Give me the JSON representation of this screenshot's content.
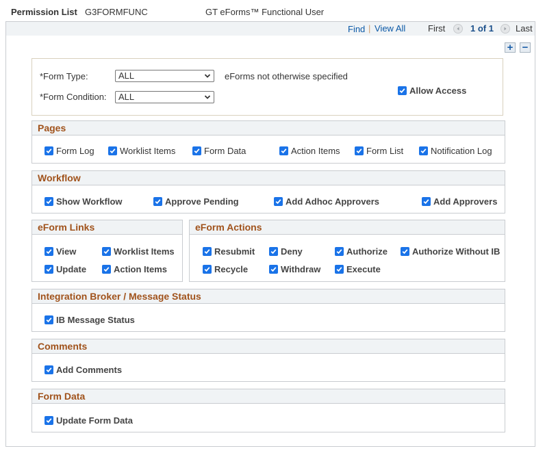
{
  "header": {
    "permission_list_label": "Permission List",
    "permission_list_value": "G3FORMFUNC",
    "description": "GT eForms™ Functional User"
  },
  "nav": {
    "find": "Find",
    "separator": "|",
    "view_all": "View All",
    "first": "First",
    "page_info": "1 of 1",
    "last": "Last"
  },
  "row_buttons": {
    "add": "+",
    "delete": "−"
  },
  "keys": {
    "form_type_label": "*Form Type:",
    "form_type_value": "ALL",
    "form_type_desc": "eForms not otherwise specified",
    "form_condition_label": "*Form Condition:",
    "form_condition_value": "ALL",
    "allow_access_label": "Allow Access",
    "allow_access_checked": true
  },
  "groups": {
    "pages": {
      "title": "Pages",
      "items": [
        {
          "label": "Form Log",
          "checked": true
        },
        {
          "label": "Worklist Items",
          "checked": true
        },
        {
          "label": "Form Data",
          "checked": true
        },
        {
          "label": "Action Items",
          "checked": true
        },
        {
          "label": "Form List",
          "checked": true
        },
        {
          "label": "Notification Log",
          "checked": true
        }
      ]
    },
    "workflow": {
      "title": "Workflow",
      "items": [
        {
          "label": "Show Workflow",
          "checked": true
        },
        {
          "label": "Approve Pending",
          "checked": true
        },
        {
          "label": "Add Adhoc Approvers",
          "checked": true
        },
        {
          "label": "Add Approvers",
          "checked": true
        }
      ]
    },
    "eform_links": {
      "title": "eForm Links",
      "items": [
        {
          "label": "View",
          "checked": true
        },
        {
          "label": "Worklist Items",
          "checked": true
        },
        {
          "label": "Update",
          "checked": true
        },
        {
          "label": "Action Items",
          "checked": true
        }
      ]
    },
    "eform_actions": {
      "title": "eForm Actions",
      "items": [
        {
          "label": "Resubmit",
          "checked": true
        },
        {
          "label": "Deny",
          "checked": true
        },
        {
          "label": "Authorize",
          "checked": true
        },
        {
          "label": "Authorize Without IB",
          "checked": true
        },
        {
          "label": "Recycle",
          "checked": true
        },
        {
          "label": "Withdraw",
          "checked": true
        },
        {
          "label": "Execute",
          "checked": true
        }
      ]
    },
    "ib_status": {
      "title": "Integration Broker / Message Status",
      "items": [
        {
          "label": "IB Message Status",
          "checked": true
        }
      ]
    },
    "comments": {
      "title": "Comments",
      "items": [
        {
          "label": "Add Comments",
          "checked": true
        }
      ]
    },
    "form_data": {
      "title": "Form Data",
      "items": [
        {
          "label": "Update Form Data",
          "checked": true
        }
      ]
    }
  },
  "colors": {
    "group_title": "#a0521b",
    "link": "#0a58a6",
    "checkbox": "#1a73e8",
    "header_band": "#f0f3f5"
  }
}
